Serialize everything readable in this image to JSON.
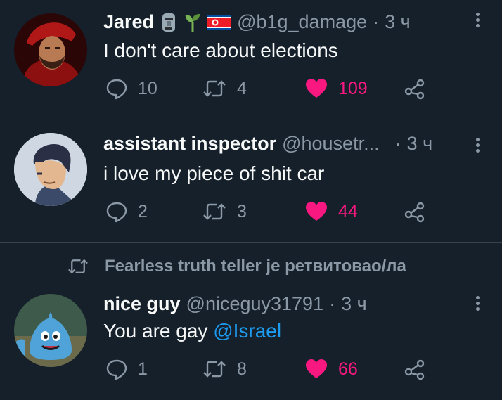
{
  "colors": {
    "background": "#15202b",
    "text": "#f7f9f9",
    "muted": "#8b98a5",
    "like": "#f91880",
    "link": "#1d9bf0"
  },
  "tweets": [
    {
      "name": "Jared",
      "emojis": [
        "moai-emoji",
        "seedling-emoji",
        "north-korea-flag-emoji"
      ],
      "handle": "@b1g_damage",
      "dot": "·",
      "time": "3 ч",
      "text": "I don't care about elections",
      "replies": "10",
      "retweets": "4",
      "likes": "109"
    },
    {
      "name": "assistant inspector",
      "handle": "@housetr...",
      "dot": "·",
      "time": "3 ч",
      "text": "i love my piece of shit car",
      "replies": "2",
      "retweets": "3",
      "likes": "44"
    },
    {
      "retweeted_by": "Fearless truth teller je ретвитовао/ла",
      "name": "nice guy",
      "handle": "@niceguy31791",
      "dot": "·",
      "time": "3 ч",
      "text": "You are gay ",
      "mention": "@Israel",
      "replies": "1",
      "retweets": "8",
      "likes": "66"
    }
  ]
}
